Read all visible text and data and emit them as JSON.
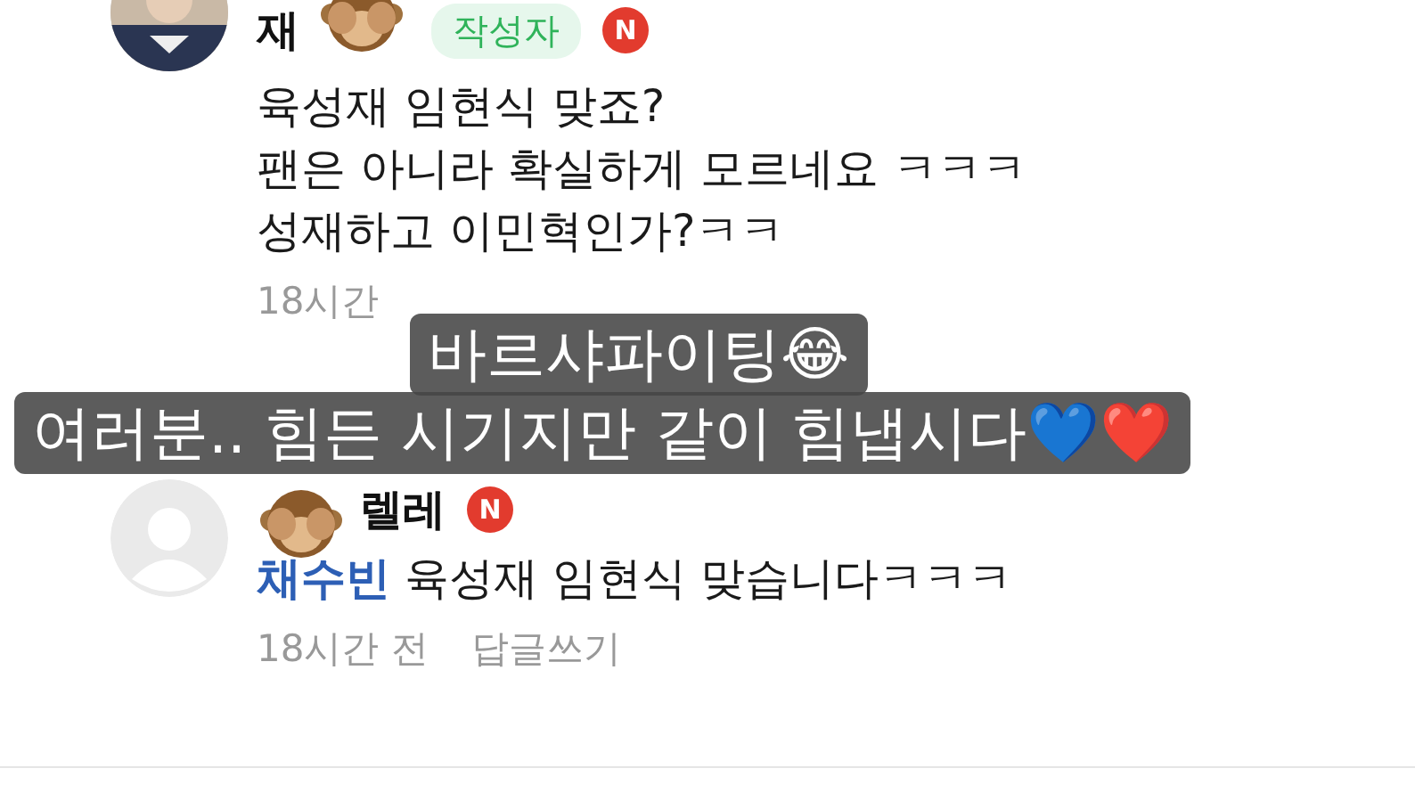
{
  "comments": [
    {
      "author": "재",
      "avatar": {
        "kind": "picture"
      },
      "badge": "작성자",
      "new_mark": "N",
      "lines": [
        "육성재 임현식 맞죠?",
        "팬은 아니라 확실하게 모르네요 ㅋㅋㅋ",
        "성재하고 이민혁인가?ㅋㅋ"
      ],
      "meta": [
        "18시간"
      ]
    },
    {
      "author": "렐레",
      "avatar": {
        "kind": "default"
      },
      "new_mark": "N",
      "mention": "채수빈",
      "lines": [
        "육성재 임현식 맞습니다ㅋㅋㅋ"
      ],
      "meta": [
        "18시간 전",
        "답글쓰기"
      ]
    }
  ],
  "captions": [
    "바르샤파이팅😂",
    "여러분.. 힘든 시기지만 같이 힘냅시다💙❤️"
  ]
}
